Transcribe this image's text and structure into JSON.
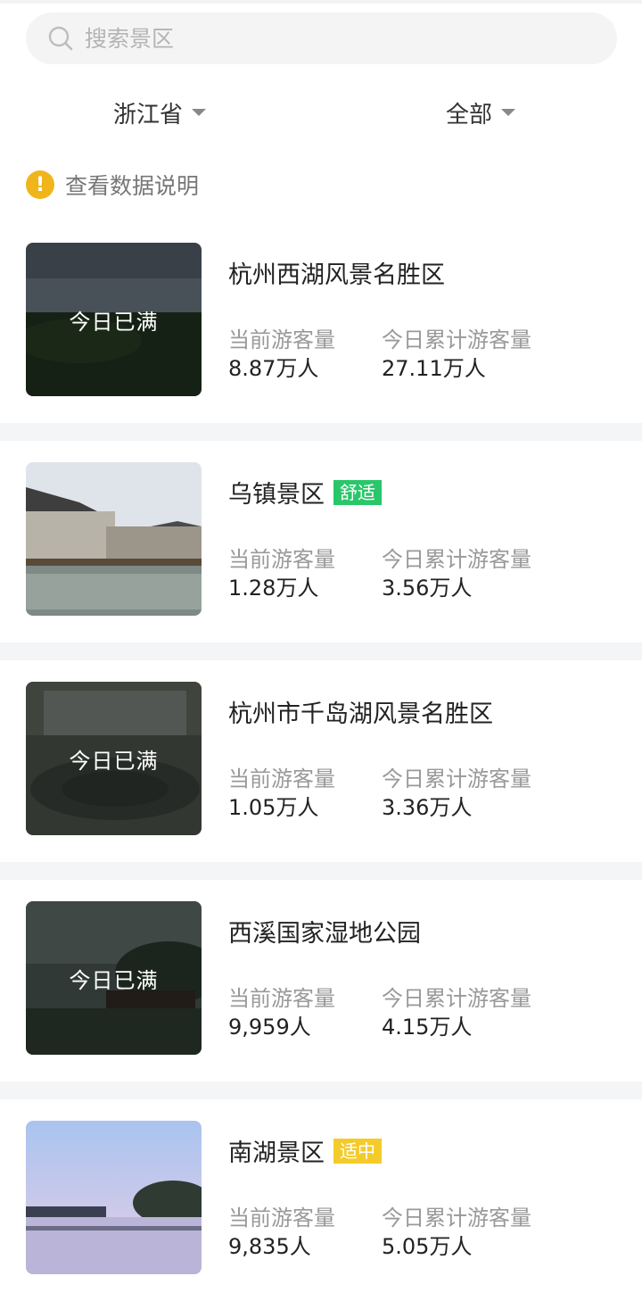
{
  "search": {
    "placeholder": "搜索景区"
  },
  "filters": {
    "province": "浙江省",
    "type": "全部"
  },
  "notice": {
    "label": "查看数据说明"
  },
  "labels": {
    "current": "当前游客量",
    "total": "今日累计游客量",
    "full": "今日已满"
  },
  "colors": {
    "badge_green": "#2ac66a",
    "badge_yellow": "#f4cb2a",
    "notice": "#f1b51c"
  },
  "scenic_spots": [
    {
      "name": "杭州西湖风景名胜区",
      "badge": "",
      "full": true,
      "current": "8.87万人",
      "total": "27.11万人"
    },
    {
      "name": "乌镇景区",
      "badge": "舒适",
      "full": false,
      "current": "1.28万人",
      "total": "3.56万人"
    },
    {
      "name": "杭州市千岛湖风景名胜区",
      "badge": "",
      "full": true,
      "current": "1.05万人",
      "total": "3.36万人"
    },
    {
      "name": "西溪国家湿地公园",
      "badge": "",
      "full": true,
      "current": "9,959人",
      "total": "4.15万人"
    },
    {
      "name": "南湖景区",
      "badge": "适中",
      "full": false,
      "current": "9,835人",
      "total": "5.05万人"
    }
  ]
}
